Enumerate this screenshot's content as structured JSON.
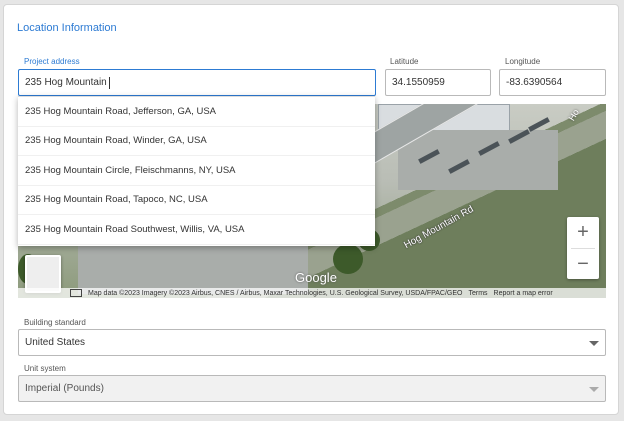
{
  "section_title": "Location Information",
  "project_address": {
    "label": "Project address",
    "value": "235 Hog Mountain"
  },
  "latitude": {
    "label": "Latitude",
    "value": "34.1550959"
  },
  "longitude": {
    "label": "Longitude",
    "value": "-83.6390564"
  },
  "suggestions": [
    "235 Hog Mountain Road, Jefferson, GA, USA",
    "235 Hog Mountain Road, Winder, GA, USA",
    "235 Hog Mountain Circle, Fleischmanns, NY, USA",
    "235 Hog Mountain Road, Tapoco, NC, USA",
    "235 Hog Mountain Road Southwest, Willis, VA, USA"
  ],
  "map": {
    "road_label": "Hog Mountain Rd",
    "road_label_edge": "Ho",
    "logo": "Google",
    "zoom_in": "+",
    "zoom_out": "−",
    "attribution": "Map data ©2023 Imagery ©2023 Airbus, CNES / Airbus, Maxar Technologies, U.S. Geological Survey, USDA/FPAC/GEO",
    "terms": "Terms",
    "report": "Report a map error"
  },
  "building_standard": {
    "label": "Building standard",
    "value": "United States"
  },
  "unit_system": {
    "label": "Unit system",
    "value": "Imperial (Pounds)"
  }
}
